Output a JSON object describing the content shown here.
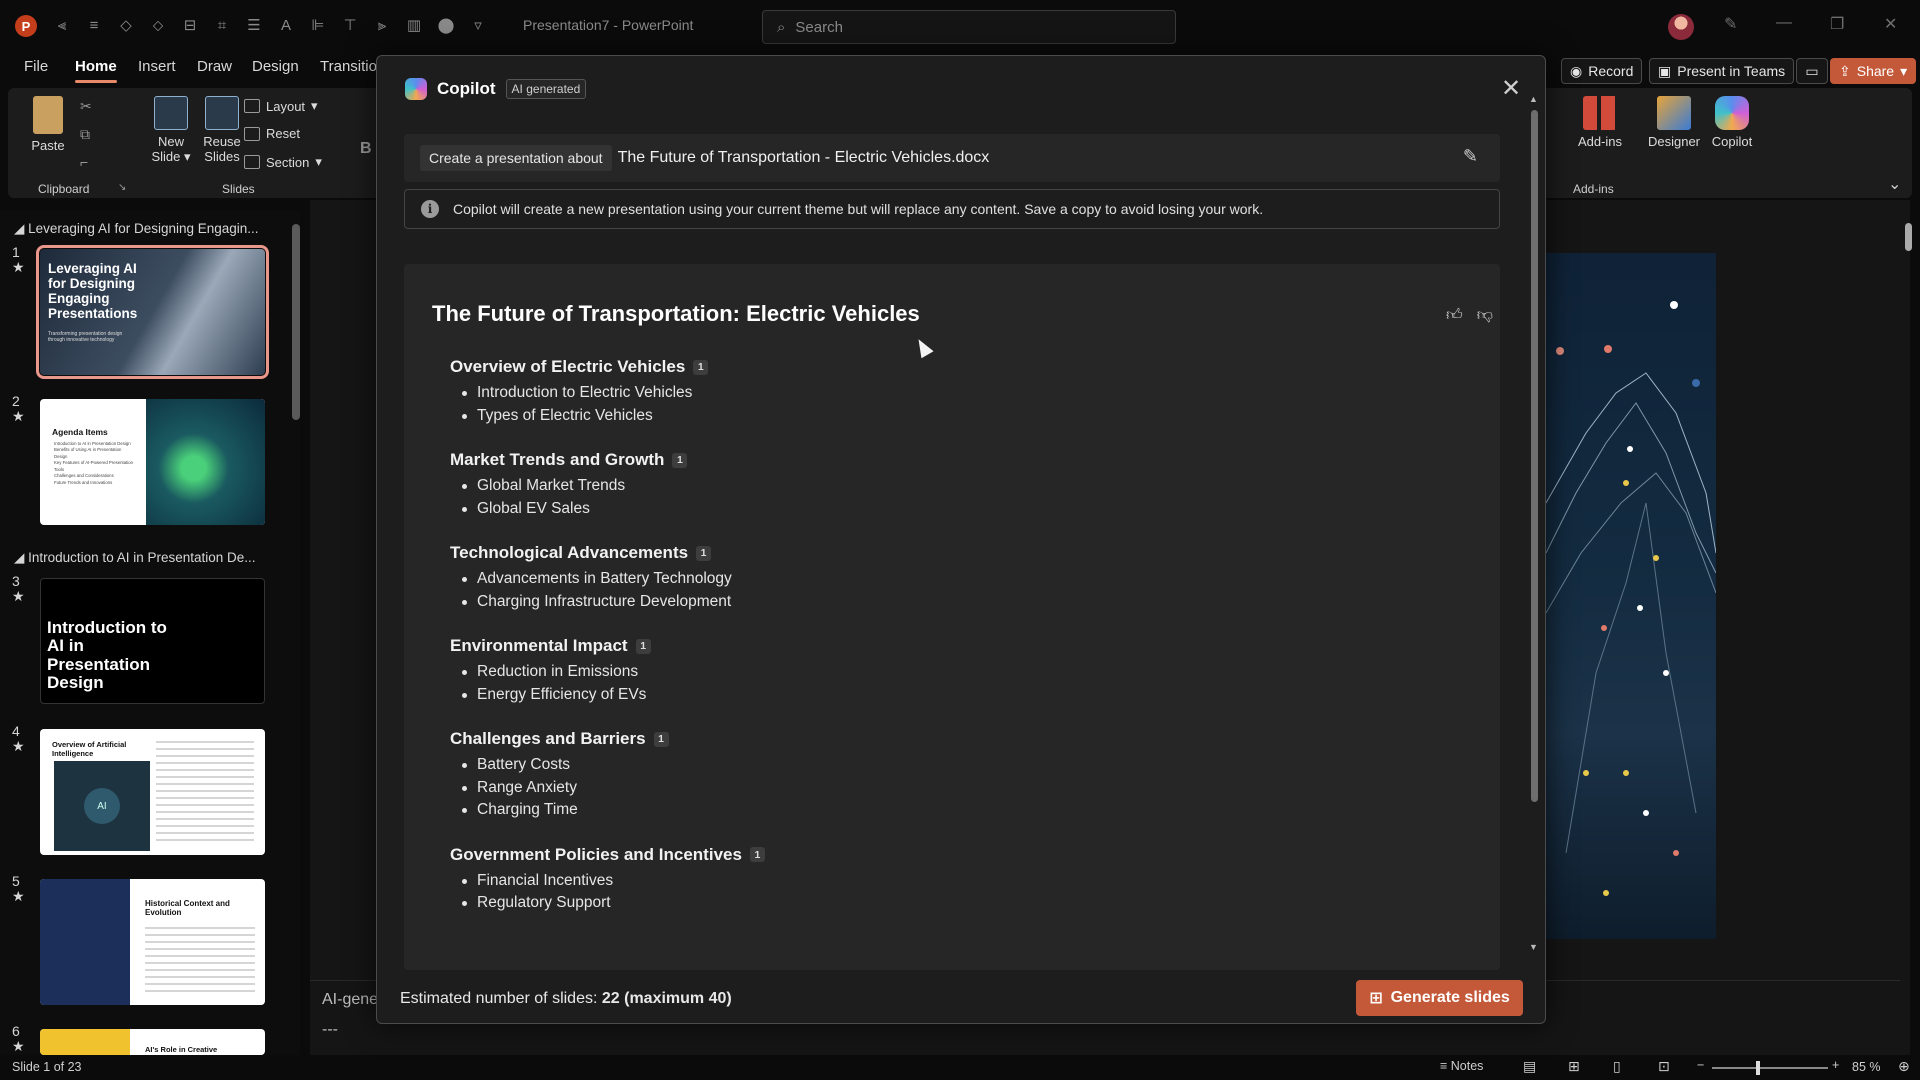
{
  "titlebar": {
    "doc_title": "Presentation7 - PowerPoint",
    "search_placeholder": "Search"
  },
  "ribbon": {
    "tabs": [
      "File",
      "Home",
      "Insert",
      "Draw",
      "Design",
      "Transitio"
    ],
    "active_tab": "Home",
    "buttons": {
      "paste": "Paste",
      "new_slide_1": "New",
      "new_slide_2": "Slide",
      "reuse_1": "Reuse",
      "reuse_2": "Slides",
      "layout": "Layout",
      "reset": "Reset",
      "section": "Section",
      "bold": "B",
      "addins": "Add-ins",
      "designer": "Designer",
      "copilot": "Copilot"
    },
    "groups": {
      "clipboard": "Clipboard",
      "slides": "Slides",
      "addins": "Add-ins"
    },
    "right": {
      "record": "Record",
      "present_teams": "Present in Teams",
      "share": "Share"
    }
  },
  "thumbnails": {
    "section1": "Leveraging AI for Designing Engagin...",
    "section2": "Introduction to AI in Presentation De...",
    "slides": [
      {
        "num": "1",
        "title": "Leveraging AI for Designing Engaging Presentations",
        "subtitle": "Transforming presentation design through innovative technology"
      },
      {
        "num": "2",
        "title": "Agenda Items",
        "items": [
          "Introduction to AI in Presentation Design",
          "Benefits of Using AI in Presentation Design",
          "Key Features of AI-Powered Presentation Tools",
          "Challenges and Considerations",
          "Future Trends and Innovations"
        ]
      },
      {
        "num": "3",
        "title": "Introduction to AI in Presentation Design"
      },
      {
        "num": "4",
        "title": "Overview of Artificial Intelligence",
        "badge": "AI"
      },
      {
        "num": "5",
        "title": "Historical Context and Evolution"
      },
      {
        "num": "6",
        "title": "AI's Role in Creative"
      }
    ]
  },
  "editor": {
    "notes_text": "AI-gene",
    "notes_dash": "---"
  },
  "statusbar": {
    "slide_count": "Slide 1 of 23",
    "notes": "Notes",
    "zoom": "85 %"
  },
  "copilot": {
    "title": "Copilot",
    "badge": "AI generated",
    "prompt_chip": "Create a presentation about",
    "prompt_text": "The Future of Transportation - Electric Vehicles.docx",
    "info": "Copilot will create a new presentation using your current theme but will replace any content. Save a copy to avoid losing your work.",
    "outline_title": "The Future of Transportation: Electric Vehicles",
    "sections": [
      {
        "heading": "Overview of Electric Vehicles",
        "cite": "1",
        "bullets": [
          "Introduction to Electric Vehicles",
          "Types of Electric Vehicles"
        ]
      },
      {
        "heading": "Market Trends and Growth",
        "cite": "1",
        "bullets": [
          "Global Market Trends",
          "Global EV Sales"
        ]
      },
      {
        "heading": "Technological Advancements",
        "cite": "1",
        "bullets": [
          "Advancements in Battery Technology",
          "Charging Infrastructure Development"
        ]
      },
      {
        "heading": "Environmental Impact",
        "cite": "1",
        "bullets": [
          "Reduction in Emissions",
          "Energy Efficiency of EVs"
        ]
      },
      {
        "heading": "Challenges and Barriers",
        "cite": "1",
        "bullets": [
          "Battery Costs",
          "Range Anxiety",
          "Charging Time"
        ]
      },
      {
        "heading": "Government Policies and Incentives",
        "cite": "1",
        "bullets": [
          "Financial Incentives",
          "Regulatory Support"
        ]
      }
    ],
    "estimate_prefix": "Estimated number of slides: ",
    "estimate_value": "22 (maximum 40)",
    "generate": "Generate slides"
  },
  "colors": {
    "accent": "#c4593a",
    "tab_underline": "#e8896a",
    "selected_thumb": "#e9968b"
  }
}
